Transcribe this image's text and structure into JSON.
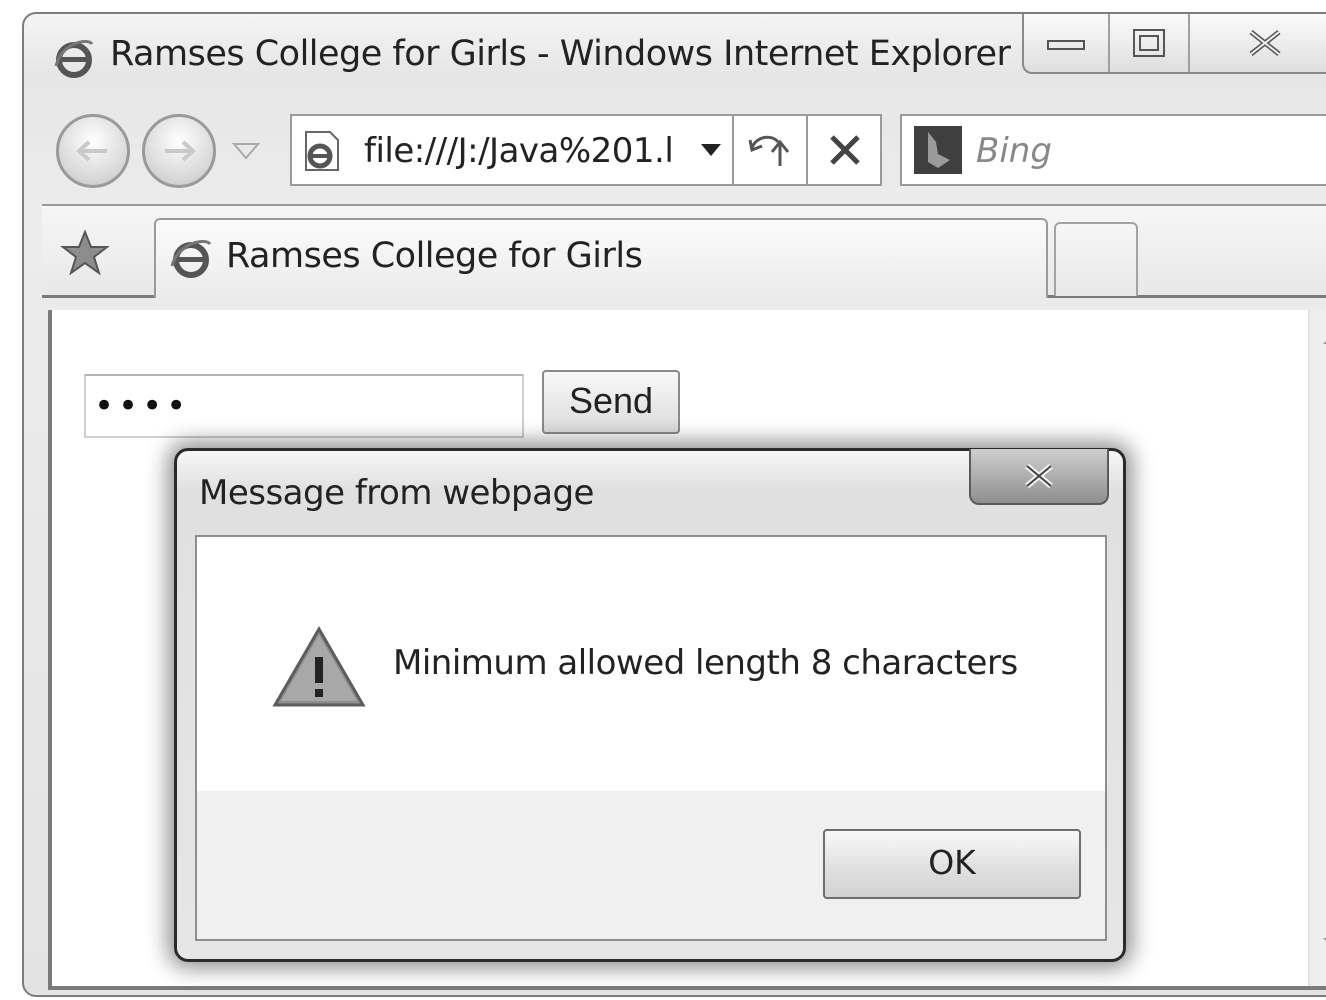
{
  "window": {
    "title": "Ramses College for Girls - Windows Internet Explorer"
  },
  "address_bar": {
    "url": "file:///J:/Java%201.l"
  },
  "search": {
    "placeholder": "Bing"
  },
  "tabs": [
    {
      "label": "Ramses College for Girls"
    }
  ],
  "page": {
    "password_value": "••••",
    "send_label": "Send"
  },
  "dialog": {
    "title": "Message from webpage",
    "message": "Minimum allowed length 8 characters",
    "ok_label": "OK"
  },
  "icons": {
    "browser": "ie-logo-icon",
    "search_provider": "bing-icon",
    "favorites": "star-icon",
    "dialog": "warning-icon"
  }
}
